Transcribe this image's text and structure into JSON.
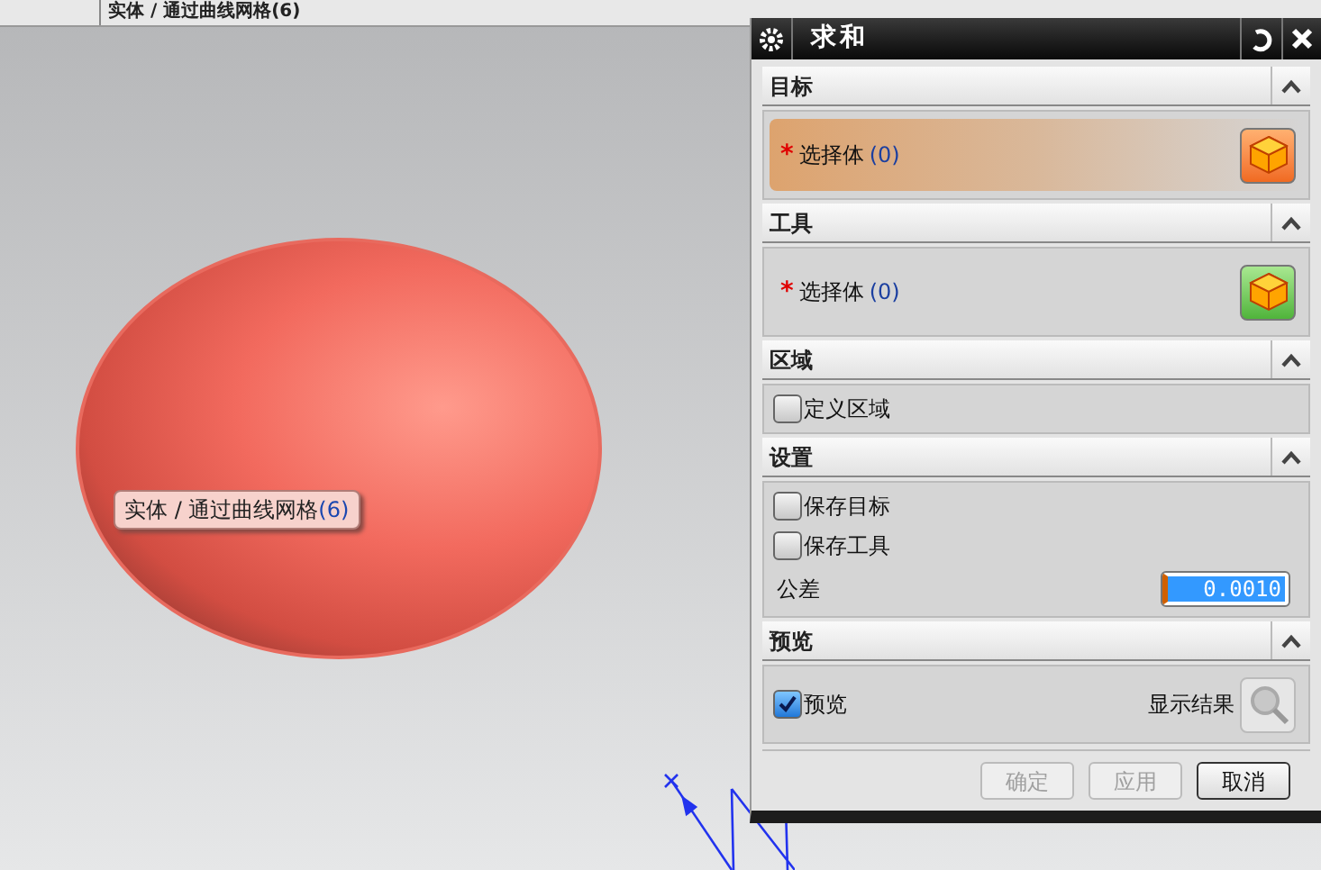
{
  "viewport": {
    "breadcrumb": "实体 / 通过曲线网格(6)",
    "tooltip": {
      "label": "实体 / 通过曲线网格",
      "count": "(6)"
    }
  },
  "dialog": {
    "title": "求和",
    "sections": [
      {
        "title": "目标",
        "expanded": true,
        "items": [
          {
            "kind": "selection",
            "label": "选择体",
            "count": "(0)",
            "marker": "*",
            "active": true
          }
        ]
      },
      {
        "title": "工具",
        "expanded": true,
        "items": [
          {
            "kind": "selection",
            "label": "选择体",
            "count": "(0)",
            "marker": "*",
            "active": false
          }
        ]
      },
      {
        "title": "区域",
        "expanded": true,
        "items": [
          {
            "kind": "checkbox",
            "label": "定义区域",
            "checked": false
          }
        ]
      },
      {
        "title": "设置",
        "expanded": true,
        "items": [
          {
            "kind": "checkbox",
            "label": "保存目标",
            "checked": false
          },
          {
            "kind": "checkbox",
            "label": "保存工具",
            "checked": false
          },
          {
            "kind": "number",
            "label": "公差",
            "value": "0.0010"
          }
        ]
      },
      {
        "title": "预览",
        "expanded": true,
        "items": [
          {
            "kind": "preview",
            "label": "预览",
            "checked": true,
            "button": "显示结果"
          }
        ]
      }
    ],
    "buttons": [
      {
        "label": "确定",
        "disabled": true
      },
      {
        "label": "应用",
        "disabled": true
      },
      {
        "label": "取消",
        "disabled": false
      }
    ]
  }
}
